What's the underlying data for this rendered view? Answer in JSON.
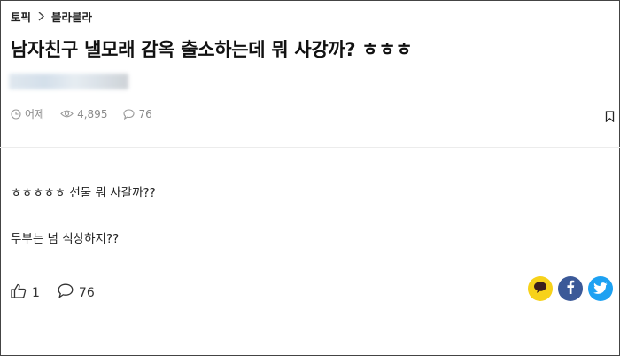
{
  "breadcrumb": {
    "topic": "토픽",
    "board": "블라블라"
  },
  "post": {
    "title": "남자친구 낼모래 감옥 출소하는데 뭐 사강까? ㅎㅎㅎ",
    "time": "어제",
    "views": "4,895",
    "comments": "76",
    "body_lines": [
      "ㅎㅎㅎㅎㅎ 선물 뭐 사갈까??",
      "두부는 넘 식상하지??"
    ]
  },
  "actions": {
    "likes": "1",
    "comments": "76"
  },
  "colors": {
    "kakao": "#f7d21a",
    "facebook": "#3b5998",
    "twitter": "#1da1f2"
  },
  "icons": [
    "clock-icon",
    "eye-icon",
    "comment-icon",
    "bookmark-icon",
    "thumbs-up-icon",
    "kakao-icon",
    "facebook-icon",
    "twitter-icon",
    "chevron-right-icon"
  ]
}
